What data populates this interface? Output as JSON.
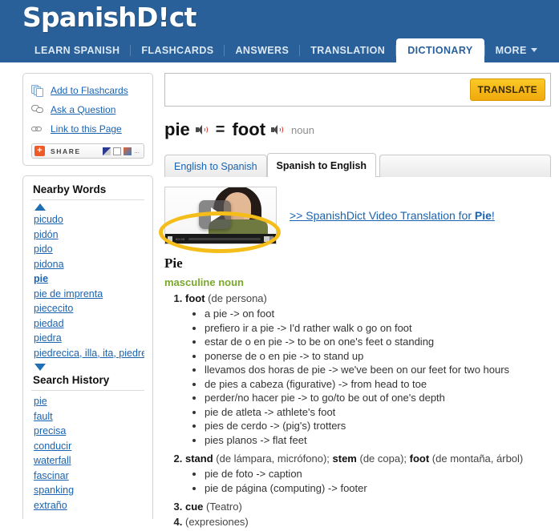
{
  "site": {
    "logo": "SpanishD!ct",
    "header_color": "#2a6099",
    "accent_color": "#f5bd1a",
    "link_color": "#1963b0"
  },
  "nav": {
    "items": [
      {
        "label": "LEARN SPANISH",
        "active": false
      },
      {
        "label": "FLASHCARDS",
        "active": false
      },
      {
        "label": "ANSWERS",
        "active": false
      },
      {
        "label": "TRANSLATION",
        "active": false
      },
      {
        "label": "DICTIONARY",
        "active": true
      },
      {
        "label": "MORE",
        "active": false,
        "caret": true
      }
    ]
  },
  "sidebar": {
    "actions": [
      {
        "icon": "flashcards-icon",
        "label": "Add to Flashcards"
      },
      {
        "icon": "question-bubble-icon",
        "label": "Ask a Question"
      },
      {
        "icon": "link-icon",
        "label": "Link to this Page"
      }
    ],
    "share": {
      "plus": "+",
      "label": "SHARE",
      "more": "..."
    },
    "nearby": {
      "title": "Nearby Words",
      "up_arrow": "scroll-up-arrow",
      "words": [
        "picudo",
        "pidón",
        "pido",
        "pidona",
        "pie",
        "pie de imprenta",
        "piececito",
        "piedad",
        "piedra",
        "piedrecica, illa, ita, piedre"
      ],
      "current": "pie",
      "down_arrow": "scroll-down-arrow"
    },
    "history": {
      "title": "Search History",
      "words": [
        "pie",
        "fault",
        "precisa",
        "conducir",
        "waterfall",
        "fascinar",
        "spanking",
        "extraño"
      ]
    }
  },
  "search": {
    "value": "",
    "placeholder": "",
    "button": "TRANSLATE"
  },
  "headword": {
    "source": "pie",
    "equals": "=",
    "target": "foot",
    "pos": "noun",
    "speaker_icon": "speaker-icon"
  },
  "tabs": [
    {
      "label": "English to Spanish",
      "active": false
    },
    {
      "label": "Spanish to English",
      "active": true
    },
    {
      "label": "",
      "active": false,
      "filler": true
    }
  ],
  "video": {
    "thumbnail": "video-thumbnail",
    "play_icon": "play-icon",
    "time": "00:00",
    "link_prefix": ">> SpanishDict Video Translation for ",
    "link_word": "Pie",
    "link_suffix": "!"
  },
  "definition": {
    "title": "Pie",
    "gender": "masculine noun",
    "senses": [
      {
        "number": "1.",
        "head": "foot",
        "qualifier": " (de persona)",
        "examples": [
          "a pie -> on foot",
          "prefiero ir a pie -> I'd rather walk o go on foot",
          "estar de o en pie -> to be on one's feet o standing",
          "ponerse de o en pie -> to stand up",
          "llevamos dos horas de pie -> we've been on our feet for two hours",
          "de pies a cabeza (figurative) -> from head to toe",
          "perder/no hacer pie -> to go/to be out of one's depth",
          "pie de atleta -> athlete's foot",
          "pies de cerdo -> (pig's) trotters",
          "pies planos -> flat feet"
        ]
      },
      {
        "number": "2.",
        "head": "stand",
        "qualifier": " (de lámpara, micrófono); ",
        "head2": "stem",
        "qualifier2": " (de copa); ",
        "head3": "foot",
        "qualifier3": " (de montaña, árbol)",
        "examples": [
          "pie de foto -> caption",
          "pie de página (computing) -> footer"
        ]
      },
      {
        "number": "3.",
        "head": "cue",
        "qualifier": " (Teatro)",
        "examples": []
      },
      {
        "number": "4.",
        "head": "",
        "qualifier": "(expresiones)",
        "examples": []
      }
    ]
  },
  "annotation": {
    "type": "ellipse-highlight",
    "target": "English to Spanish",
    "color": "#f5bd1a"
  }
}
